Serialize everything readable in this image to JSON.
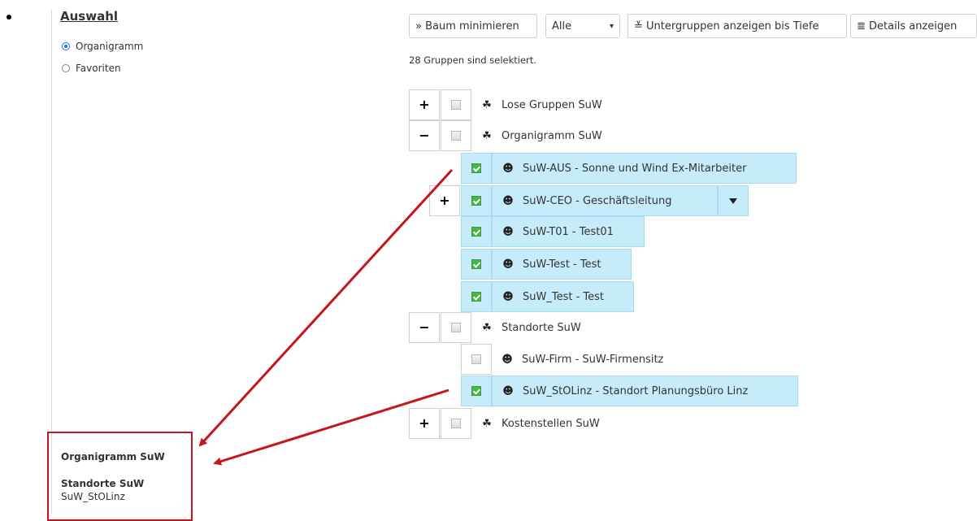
{
  "sidebar": {
    "title": "Auswahl",
    "radios": [
      {
        "label": "Organigramm",
        "checked": true
      },
      {
        "label": "Favoriten",
        "checked": false
      }
    ],
    "selection": {
      "group1": "Organigramm SuW",
      "group2": "Standorte SuW",
      "item": "SuW_StOLinz"
    }
  },
  "toolbar": {
    "minimize": "» Baum minimieren",
    "filter_value": "Alle",
    "depth": "≚ Untergruppen anzeigen bis Tiefe",
    "details": "≣ Details anzeigen"
  },
  "status": "28 Gruppen sind selektiert.",
  "tree": {
    "n1": "Lose Gruppen SuW",
    "n2": "Organigramm SuW",
    "n2a": "SuW-AUS - Sonne und Wind Ex-Mitarbeiter",
    "n2b": "SuW-CEO - Geschäftsleitung",
    "n2c": "SuW-T01 - Test01",
    "n2d": "SuW-Test - Test",
    "n2e": "SuW_Test - Test",
    "n3": "Standorte SuW",
    "n3a": "SuW-Firm - SuW-Firmensitz",
    "n3b": "SuW_StOLinz - Standort Planungsbüro Linz",
    "n4": "Kostenstellen SuW"
  },
  "symbols": {
    "plus": "+",
    "minus": "−"
  },
  "colors": {
    "selected_bg": "#c6ecfb",
    "check_green": "#47b747",
    "annotation_red": "#c4161c"
  }
}
